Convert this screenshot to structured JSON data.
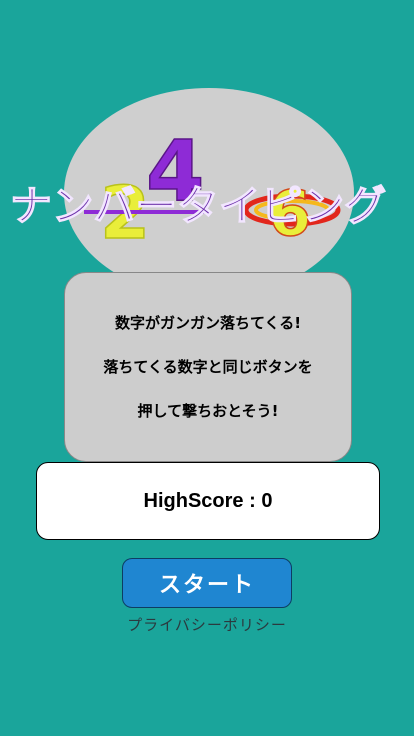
{
  "logo": {
    "title": "ナンバータイピング",
    "digit_top": "4",
    "digit_left": "2",
    "digit_right": "6"
  },
  "description": {
    "line1": "数字がガンガン落ちてくる!",
    "line2": "落ちてくる数字と同じボタンを",
    "line3": "押して撃ちおとそう!"
  },
  "score": {
    "label": "HighScore : 0"
  },
  "buttons": {
    "start_label": "スタート",
    "privacy_label": "プライバシーポリシー"
  },
  "colors": {
    "background": "#1aa59b",
    "title_fill": "#6b2fa8",
    "start_button": "#1f86d1"
  }
}
